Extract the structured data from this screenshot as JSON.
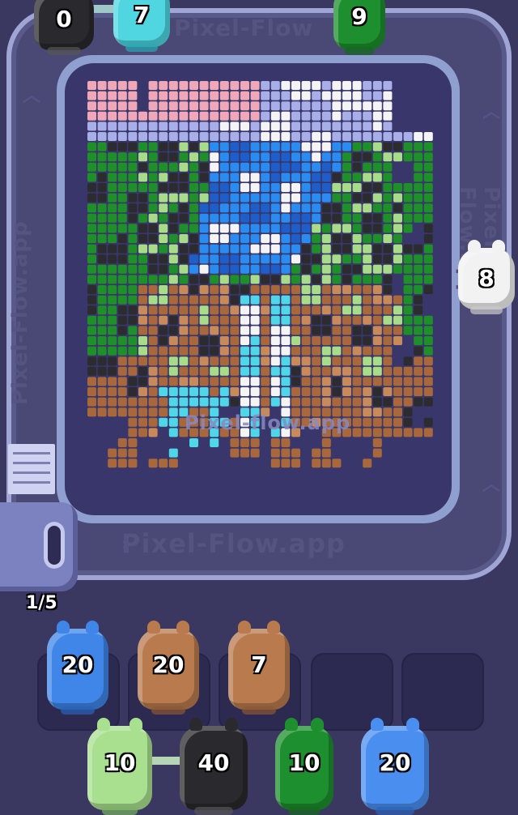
{
  "board": {
    "watermark_top": "Pixel-Flow",
    "watermark_bottom": "Pixel-Flow.app",
    "watermark_center": "Pixel-flow.app",
    "watermark_left": "Pixel-Flow.app",
    "watermark_right": "Pixel-Flow.app"
  },
  "track_shooters": [
    {
      "count": "0",
      "color": "#2a2a2e",
      "accent": "#555"
    },
    {
      "count": "7",
      "color": "#4fd6e0",
      "accent": "#2aa8b4"
    },
    {
      "count": "9",
      "color": "#1e8f2e",
      "accent": "#14691f"
    },
    {
      "count": "8",
      "color": "#f2f2f2",
      "accent": "#c9c9c9"
    }
  ],
  "progress": {
    "label": "1/5"
  },
  "slots": [
    {
      "count": "20",
      "color": "#3f86e8",
      "accent": "#2a62b8"
    },
    {
      "count": "20",
      "color": "#b97a4e",
      "accent": "#8d5733"
    },
    {
      "count": "7",
      "color": "#b97a4e",
      "accent": "#8d5733"
    },
    {
      "count": "",
      "color": "",
      "accent": ""
    },
    {
      "count": "",
      "color": "",
      "accent": ""
    }
  ],
  "queue": [
    {
      "count": "10",
      "color": "#a9e08f",
      "accent": "#79b063"
    },
    {
      "count": "40",
      "color": "#2a2a2e",
      "accent": "#555"
    },
    {
      "count": "10",
      "color": "#1e8f2e",
      "accent": "#14691f"
    },
    {
      "count": "20",
      "color": "#4a8ff0",
      "accent": "#2a62b8"
    }
  ],
  "palette": {
    "pink": "#f0a8b8",
    "lavender": "#a8aee8",
    "white": "#f4f4f4",
    "blue": "#2a8cf0",
    "dark_blue": "#1f5ec8",
    "cyan": "#4fd6e8",
    "black": "#2c2c30",
    "green": "#1f8f2a",
    "light_green": "#a9dc88",
    "brown": "#a8683c",
    "light_brown": "#c98a5a"
  }
}
